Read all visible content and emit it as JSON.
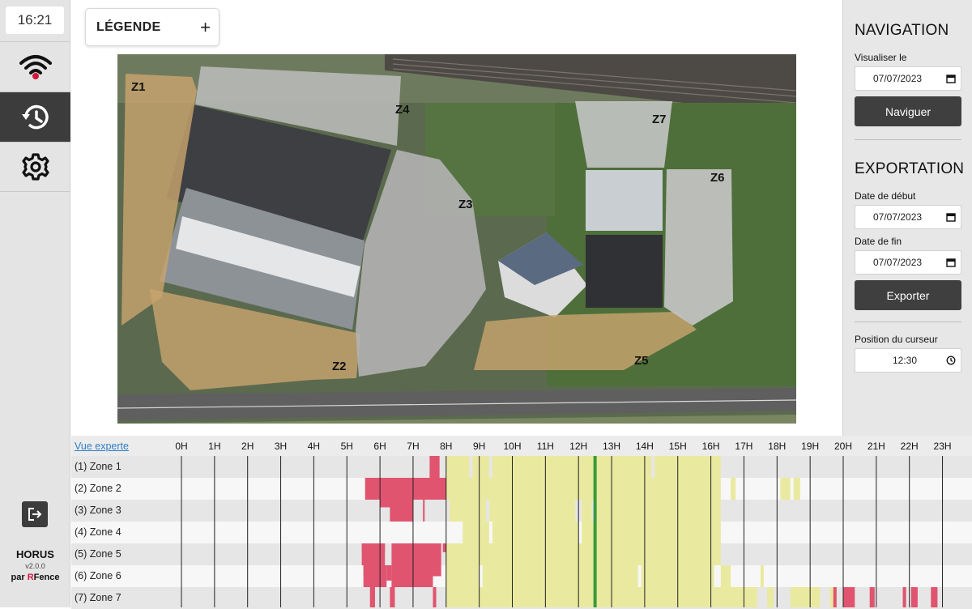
{
  "sidebar": {
    "clock": "16:21",
    "items": [
      {
        "icon": "wifi-alert-icon",
        "active": false
      },
      {
        "icon": "history-icon",
        "active": true
      },
      {
        "icon": "gear-icon",
        "active": false
      }
    ],
    "logout_icon": "logout-icon",
    "brand": {
      "name": "HORUS",
      "version": "v2.0.0",
      "by_prefix": "par ",
      "by_r": "R",
      "by_rest": "Fence"
    }
  },
  "legend": {
    "label": "LÉGENDE",
    "toggle": "+"
  },
  "map": {
    "zones": [
      "Z1",
      "Z2",
      "Z3",
      "Z4",
      "Z5",
      "Z6",
      "Z7"
    ]
  },
  "right_panel": {
    "navigation": {
      "title": "NAVIGATION",
      "label": "Visualiser le",
      "date": "07/07/2023",
      "button": "Naviguer"
    },
    "exportation": {
      "title": "EXPORTATION",
      "start_label": "Date de début",
      "start_date": "07/07/2023",
      "end_label": "Date de fin",
      "end_date": "07/07/2023",
      "button": "Exporter"
    },
    "cursor": {
      "label": "Position du curseur",
      "time": "12:30"
    }
  },
  "timeline": {
    "expert_link": "Vue experte",
    "hours": [
      "0H",
      "1H",
      "2H",
      "3H",
      "4H",
      "5H",
      "6H",
      "7H",
      "8H",
      "9H",
      "10H",
      "11H",
      "12H",
      "13H",
      "14H",
      "15H",
      "16H",
      "17H",
      "18H",
      "19H",
      "20H",
      "21H",
      "22H",
      "23H"
    ],
    "rows": [
      "(1) Zone 1",
      "(2) Zone 2",
      "(3) Zone 3",
      "(4) Zone 4",
      "(5) Zone 5",
      "(6) Zone 6",
      "(7) Zone 7"
    ],
    "cursor_hour": 12.5,
    "colors": {
      "alarm": "#e05470",
      "activity": "#e9eaa0",
      "cursor": "#3a9a3a"
    }
  }
}
